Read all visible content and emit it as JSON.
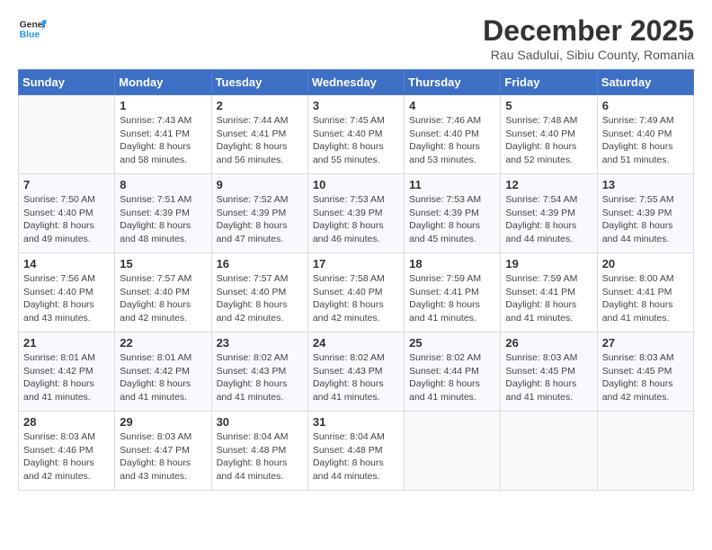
{
  "header": {
    "logo_line1": "General",
    "logo_line2": "Blue",
    "month_title": "December 2025",
    "location": "Rau Sadului, Sibiu County, Romania"
  },
  "weekdays": [
    "Sunday",
    "Monday",
    "Tuesday",
    "Wednesday",
    "Thursday",
    "Friday",
    "Saturday"
  ],
  "weeks": [
    [
      {
        "day": "",
        "empty": true
      },
      {
        "day": "1",
        "sunrise": "7:43 AM",
        "sunset": "4:41 PM",
        "daylight": "8 hours and 58 minutes."
      },
      {
        "day": "2",
        "sunrise": "7:44 AM",
        "sunset": "4:41 PM",
        "daylight": "8 hours and 56 minutes."
      },
      {
        "day": "3",
        "sunrise": "7:45 AM",
        "sunset": "4:40 PM",
        "daylight": "8 hours and 55 minutes."
      },
      {
        "day": "4",
        "sunrise": "7:46 AM",
        "sunset": "4:40 PM",
        "daylight": "8 hours and 53 minutes."
      },
      {
        "day": "5",
        "sunrise": "7:48 AM",
        "sunset": "4:40 PM",
        "daylight": "8 hours and 52 minutes."
      },
      {
        "day": "6",
        "sunrise": "7:49 AM",
        "sunset": "4:40 PM",
        "daylight": "8 hours and 51 minutes."
      }
    ],
    [
      {
        "day": "7",
        "sunrise": "7:50 AM",
        "sunset": "4:40 PM",
        "daylight": "8 hours and 49 minutes."
      },
      {
        "day": "8",
        "sunrise": "7:51 AM",
        "sunset": "4:39 PM",
        "daylight": "8 hours and 48 minutes."
      },
      {
        "day": "9",
        "sunrise": "7:52 AM",
        "sunset": "4:39 PM",
        "daylight": "8 hours and 47 minutes."
      },
      {
        "day": "10",
        "sunrise": "7:53 AM",
        "sunset": "4:39 PM",
        "daylight": "8 hours and 46 minutes."
      },
      {
        "day": "11",
        "sunrise": "7:53 AM",
        "sunset": "4:39 PM",
        "daylight": "8 hours and 45 minutes."
      },
      {
        "day": "12",
        "sunrise": "7:54 AM",
        "sunset": "4:39 PM",
        "daylight": "8 hours and 44 minutes."
      },
      {
        "day": "13",
        "sunrise": "7:55 AM",
        "sunset": "4:39 PM",
        "daylight": "8 hours and 44 minutes."
      }
    ],
    [
      {
        "day": "14",
        "sunrise": "7:56 AM",
        "sunset": "4:40 PM",
        "daylight": "8 hours and 43 minutes."
      },
      {
        "day": "15",
        "sunrise": "7:57 AM",
        "sunset": "4:40 PM",
        "daylight": "8 hours and 42 minutes."
      },
      {
        "day": "16",
        "sunrise": "7:57 AM",
        "sunset": "4:40 PM",
        "daylight": "8 hours and 42 minutes."
      },
      {
        "day": "17",
        "sunrise": "7:58 AM",
        "sunset": "4:40 PM",
        "daylight": "8 hours and 42 minutes."
      },
      {
        "day": "18",
        "sunrise": "7:59 AM",
        "sunset": "4:41 PM",
        "daylight": "8 hours and 41 minutes."
      },
      {
        "day": "19",
        "sunrise": "7:59 AM",
        "sunset": "4:41 PM",
        "daylight": "8 hours and 41 minutes."
      },
      {
        "day": "20",
        "sunrise": "8:00 AM",
        "sunset": "4:41 PM",
        "daylight": "8 hours and 41 minutes."
      }
    ],
    [
      {
        "day": "21",
        "sunrise": "8:01 AM",
        "sunset": "4:42 PM",
        "daylight": "8 hours and 41 minutes."
      },
      {
        "day": "22",
        "sunrise": "8:01 AM",
        "sunset": "4:42 PM",
        "daylight": "8 hours and 41 minutes."
      },
      {
        "day": "23",
        "sunrise": "8:02 AM",
        "sunset": "4:43 PM",
        "daylight": "8 hours and 41 minutes."
      },
      {
        "day": "24",
        "sunrise": "8:02 AM",
        "sunset": "4:43 PM",
        "daylight": "8 hours and 41 minutes."
      },
      {
        "day": "25",
        "sunrise": "8:02 AM",
        "sunset": "4:44 PM",
        "daylight": "8 hours and 41 minutes."
      },
      {
        "day": "26",
        "sunrise": "8:03 AM",
        "sunset": "4:45 PM",
        "daylight": "8 hours and 41 minutes."
      },
      {
        "day": "27",
        "sunrise": "8:03 AM",
        "sunset": "4:45 PM",
        "daylight": "8 hours and 42 minutes."
      }
    ],
    [
      {
        "day": "28",
        "sunrise": "8:03 AM",
        "sunset": "4:46 PM",
        "daylight": "8 hours and 42 minutes."
      },
      {
        "day": "29",
        "sunrise": "8:03 AM",
        "sunset": "4:47 PM",
        "daylight": "8 hours and 43 minutes."
      },
      {
        "day": "30",
        "sunrise": "8:04 AM",
        "sunset": "4:48 PM",
        "daylight": "8 hours and 44 minutes."
      },
      {
        "day": "31",
        "sunrise": "8:04 AM",
        "sunset": "4:48 PM",
        "daylight": "8 hours and 44 minutes."
      },
      {
        "day": "",
        "empty": true
      },
      {
        "day": "",
        "empty": true
      },
      {
        "day": "",
        "empty": true
      }
    ]
  ]
}
